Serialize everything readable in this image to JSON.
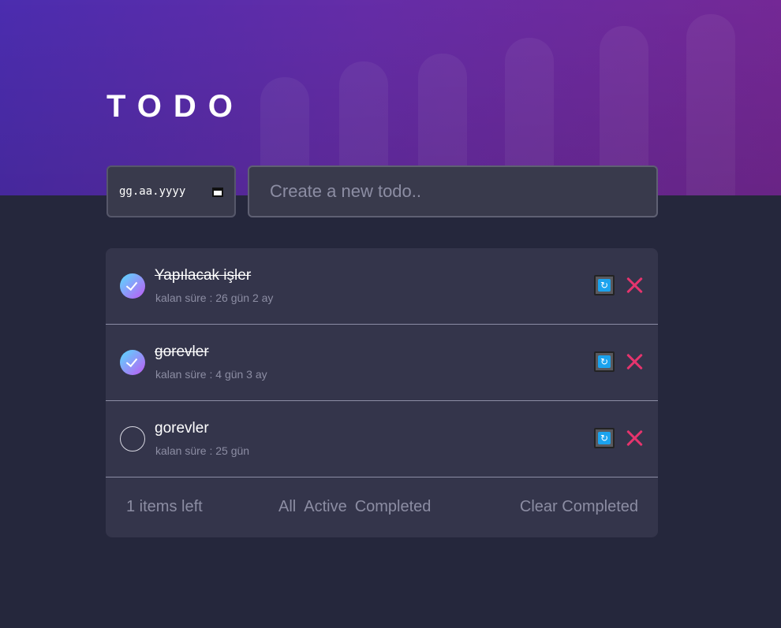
{
  "header": {
    "title": "TODO"
  },
  "date_input": {
    "placeholder": "gg.aa.yyyy"
  },
  "new_todo": {
    "placeholder": "Create a new todo.."
  },
  "todos": [
    {
      "title": "Yapılacak işler",
      "meta": "kalan süre : 26 gün 2 ay",
      "completed": true
    },
    {
      "title": "gorevler",
      "meta": "kalan süre : 4 gün 3 ay",
      "completed": true
    },
    {
      "title": "gorevler",
      "meta": "kalan süre : 25 gün",
      "completed": false
    }
  ],
  "footer": {
    "items_left": "1 items left",
    "filters": {
      "all": "All",
      "active": "Active",
      "completed": "Completed"
    },
    "clear_completed": "Clear Completed"
  },
  "colors": {
    "background": "#25273c",
    "card": "#34354b",
    "check_gradient_start": "#57ddff",
    "check_gradient_end": "#c058f3",
    "delete": "#e5346d",
    "refresh": "#1ba3ee"
  },
  "icons": [
    "calendar-icon",
    "check-icon",
    "refresh-icon",
    "close-icon"
  ]
}
